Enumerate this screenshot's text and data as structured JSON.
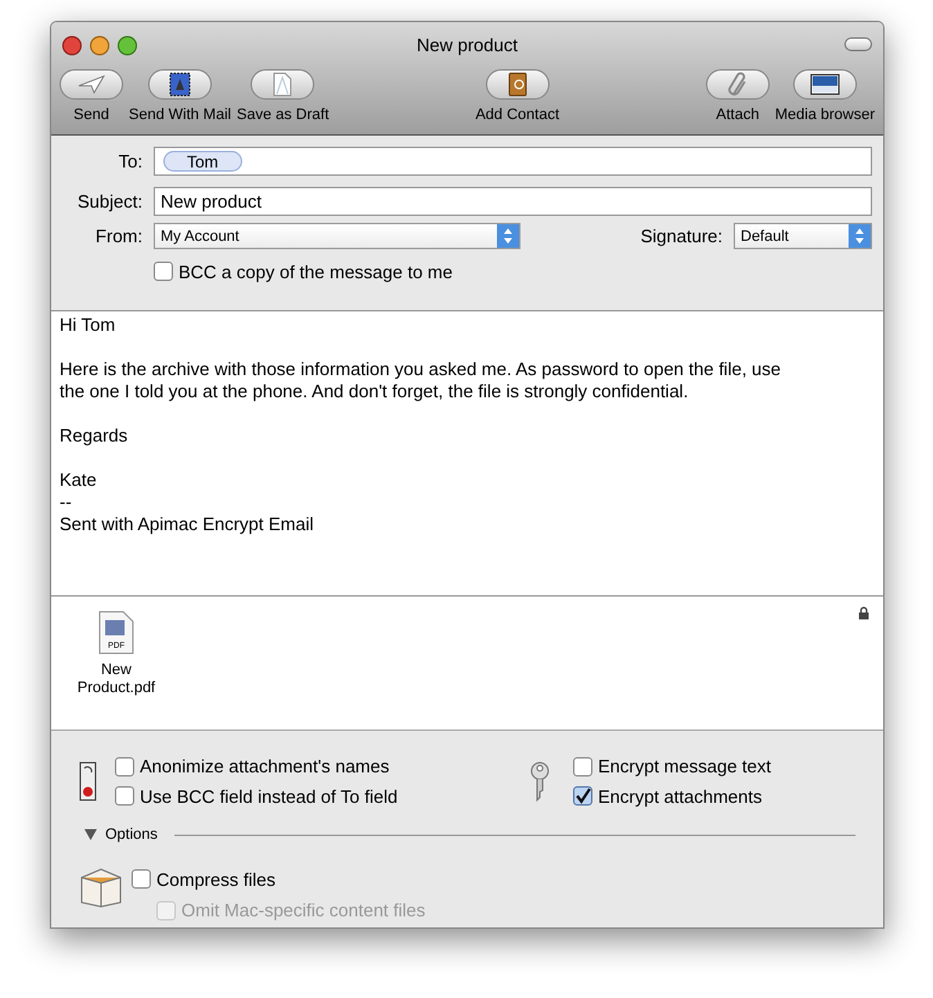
{
  "window": {
    "title": "New product"
  },
  "toolbar": [
    {
      "label": "Send",
      "kind": "send"
    },
    {
      "label": "Send With Mail",
      "kind": "stamp"
    },
    {
      "label": "Save as Draft",
      "kind": "draft"
    },
    {
      "label": "Add Contact",
      "kind": "contact"
    },
    {
      "label": "Attach",
      "kind": "clip"
    },
    {
      "label": "Media browser",
      "kind": "media"
    }
  ],
  "header": {
    "to_label": "To:",
    "recipients": [
      "Tom"
    ],
    "subject_label": "Subject:",
    "subject": "New product",
    "from_label": "From:",
    "from": "My Account",
    "signature_label": "Signature:",
    "signature": "Default",
    "bcc": {
      "label": "BCC a copy of the message to me",
      "checked": false
    }
  },
  "body": [
    [
      "Hi Tom"
    ],
    [
      "Here is the archive with those information you asked me. As password to open the file, use",
      "the one I told you at the phone. And don't forget, the file is strongly confidential."
    ],
    [
      "Regards"
    ],
    [
      "Kate",
      "--",
      "Sent with Apimac Encrypt Email"
    ]
  ],
  "attachments": [
    {
      "name_lines": [
        "New",
        "Product.pdf"
      ],
      "badge": "PDF"
    }
  ],
  "privacy_options": [
    {
      "label": "Anonimize attachment's names",
      "checked": false
    },
    {
      "label": "Use BCC field instead of To field",
      "checked": false
    }
  ],
  "encryption_options": [
    {
      "label": "Encrypt message text",
      "checked": false
    },
    {
      "label": "Encrypt attachments",
      "checked": true
    }
  ],
  "options_section": {
    "label": "Options",
    "expanded": true,
    "compress": {
      "label": "Compress files",
      "checked": false
    },
    "omit": {
      "label": "Omit Mac-specific content files",
      "checked": false,
      "disabled": true
    }
  }
}
